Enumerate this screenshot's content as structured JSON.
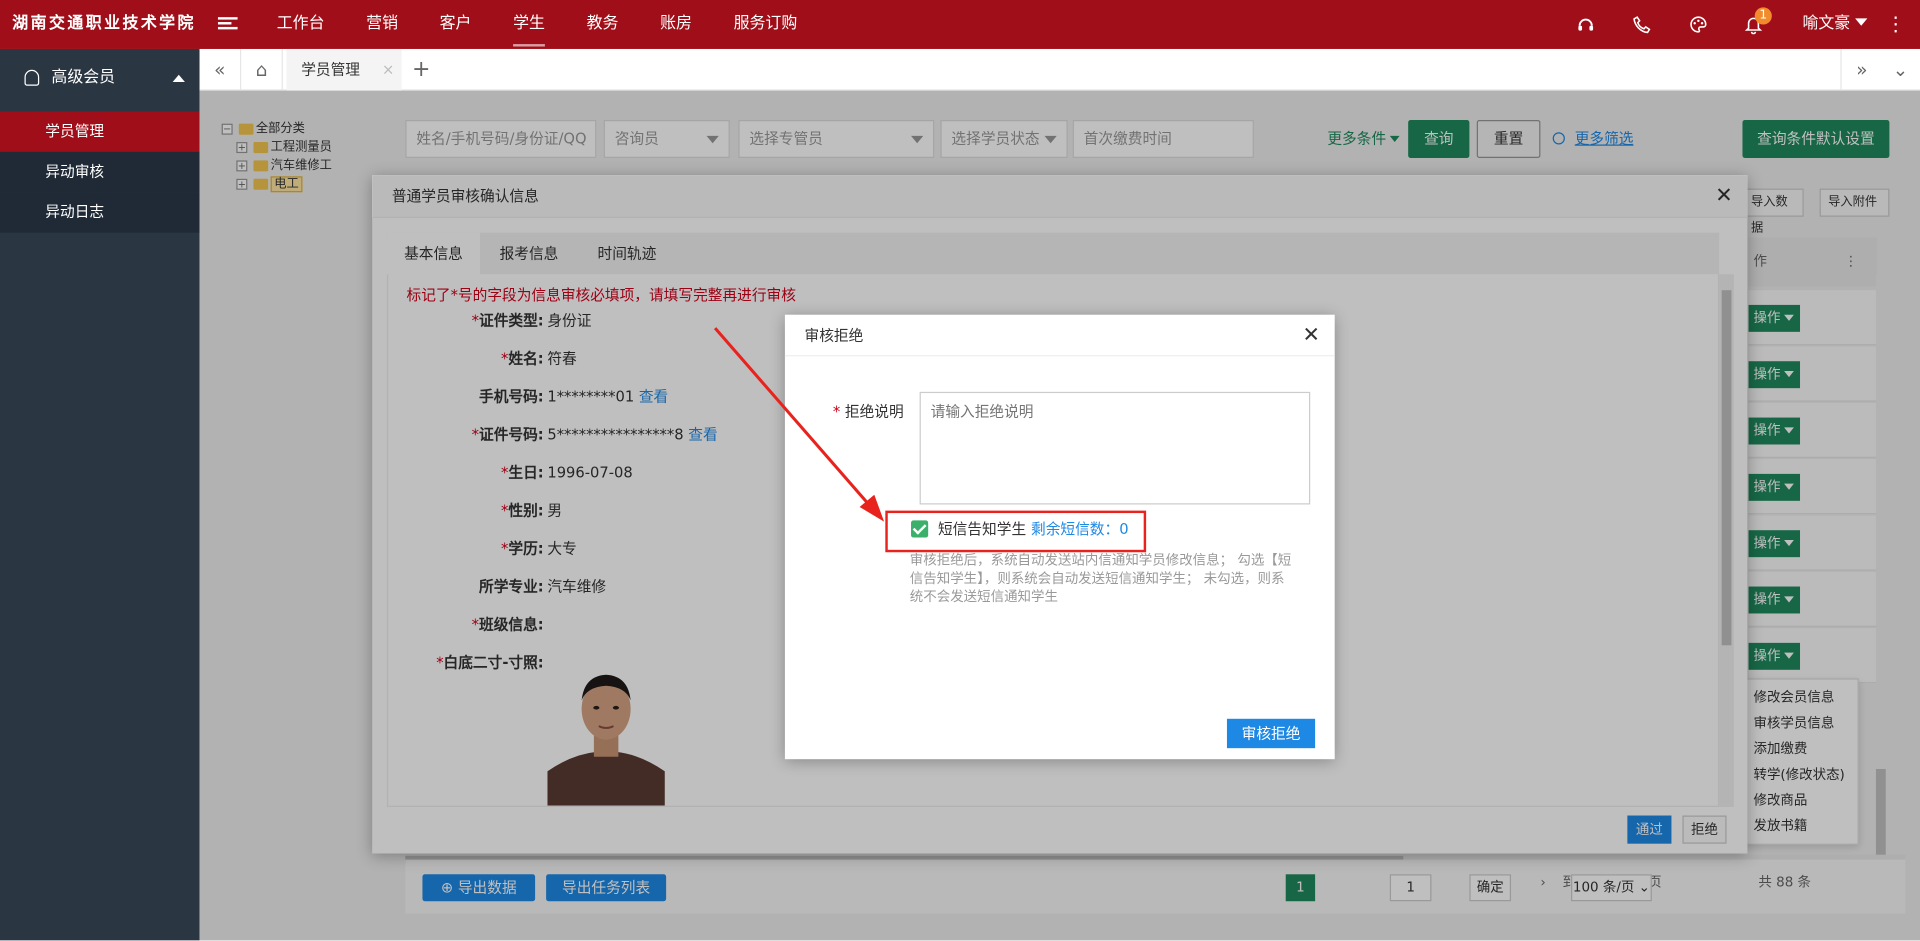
{
  "app": {
    "brand": "湖南交通职业技术学院"
  },
  "topnav": {
    "items": [
      "工作台",
      "营销",
      "客户",
      "学生",
      "教务",
      "账房",
      "服务订购"
    ],
    "active": "学生"
  },
  "topbar": {
    "notification_count": "1",
    "user": "喻文豪"
  },
  "sidebar": {
    "header": "高级会员",
    "items": [
      "学员管理",
      "异动审核",
      "异动日志"
    ]
  },
  "tabs": {
    "current": "学员管理"
  },
  "tree": {
    "root": "全部分类",
    "children": [
      "工程测量员",
      "汽车维修工",
      "电工"
    ]
  },
  "search": {
    "keyword_placeholder": "姓名/手机号码/身份证/QQ",
    "consultant_placeholder": "咨询员",
    "manager_placeholder": "选择专管员",
    "status_placeholder": "选择学员状态",
    "date_placeholder": "首次缴费时间",
    "more_conditions": "更多条件",
    "query": "查询",
    "reset": "重置",
    "more_filter": "更多筛选",
    "default_settings": "查询条件默认设置"
  },
  "toolbar": {
    "import_data": "导入数据",
    "import_attachment": "导入附件"
  },
  "table": {
    "op_header": "作",
    "op_button": "操作"
  },
  "row_menu": [
    "修改会员信息",
    "审核学员信息",
    "添加缴费",
    "转学(修改状态)",
    "修改商品",
    "发放书籍"
  ],
  "bottom": {
    "export_data": "导出数据",
    "export_tasks": "导出任务列表",
    "goto_label": "到第",
    "page_input": "1",
    "page_unit": "页",
    "confirm": "确定",
    "total": "共 88 条",
    "page_size": "100 条/页",
    "current_page": "1"
  },
  "modal1": {
    "title": "普通学员审核确认信息",
    "tabs": [
      "基本信息",
      "报考信息",
      "时间轨迹"
    ],
    "notice": "标记了*号的字段为信息审核必填项，请填写完整再进行审核",
    "fields": [
      {
        "label": "证件类型:",
        "value": "身份证",
        "link": ""
      },
      {
        "label": "姓名:",
        "value": "符春",
        "link": ""
      },
      {
        "label": "手机号码:",
        "value": "1********01",
        "link": "查看"
      },
      {
        "label": "证件号码:",
        "value": "5****************8",
        "link": "查看"
      },
      {
        "label": "生日:",
        "value": "1996-07-08",
        "link": ""
      },
      {
        "label": "性别:",
        "value": "男",
        "link": ""
      },
      {
        "label": "学历:",
        "value": "大专",
        "link": ""
      },
      {
        "label": "所学专业:",
        "value": "汽车维修",
        "link": ""
      },
      {
        "label": "班级信息:",
        "value": "",
        "link": ""
      },
      {
        "label": "白底二寸-寸照:",
        "value": "",
        "link": ""
      }
    ],
    "pass": "通过",
    "reject": "拒绝"
  },
  "modal2": {
    "title": "审核拒绝",
    "reason_label": "拒绝说明",
    "reason_placeholder": "请输入拒绝说明",
    "sms_label": "短信告知学生",
    "sms_remaining": "剩余短信数：0",
    "hint": "审核拒绝后，系统自动发送站内信通知学员修改信息；  勾选【短信告知学生】，则系统会自动发送短信通知学生；  未勾选，则系统不会发送短信通知学生",
    "submit": "审核拒绝"
  },
  "colors": {
    "brand_red": "#a00f19",
    "sidebar_bg": "#2b3643",
    "green": "#1f8a5e",
    "blue": "#1e88e5",
    "annotation_red": "#e8231e"
  }
}
